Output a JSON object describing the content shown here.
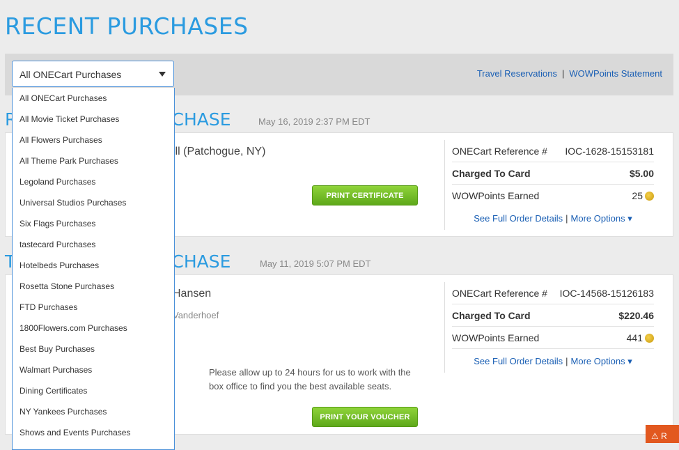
{
  "page": {
    "title": "RECENT PURCHASES"
  },
  "filter": {
    "selected": "All ONECart Purchases",
    "options": [
      "All ONECart Purchases",
      "All Movie Ticket Purchases",
      "All Flowers Purchases",
      "All Theme Park Purchases",
      "Legoland Purchases",
      "Universal Studios Purchases",
      "Six Flags Purchases",
      "tastecard Purchases",
      "Hotelbeds Purchases",
      "Rosetta Stone Purchases",
      "FTD Purchases",
      "1800Flowers.com Purchases",
      "Best Buy Purchases",
      "Walmart Purchases",
      "Dining Certificates",
      "NY Yankees Purchases",
      "Shows and Events Purchases"
    ]
  },
  "top_links": {
    "travel": "Travel Reservations",
    "separator": "|",
    "wowpoints": "WOWPoints Statement"
  },
  "purchases": [
    {
      "title_visible": "RCHASE",
      "title_prefix": "R",
      "date": "May 16, 2019 2:37 PM EDT",
      "venue_visible": "ill (Patchogue, NY)",
      "subline": "",
      "button": "PRINT CERTIFICATE",
      "notice": "",
      "ref_label": "ONECart Reference #",
      "ref_value": "IOC-1628-15153181",
      "charged_label": "Charged To Card",
      "charged_value": "$5.00",
      "points_label": "WOWPoints Earned",
      "points_value": "25",
      "details_link": "See Full Order Details",
      "options_link": "More Options ▾"
    },
    {
      "title_visible": "RCHASE",
      "title_prefix": "T",
      "date": "May 11, 2019 5:07 PM EDT",
      "venue_visible": "Hansen",
      "subline": "Vanderhoef",
      "button": "PRINT YOUR VOUCHER",
      "notice": "Please allow up to 24 hours for us to work with the box office to find you the best available seats.",
      "ref_label": "ONECart Reference #",
      "ref_value": "IOC-14568-15126183",
      "charged_label": "Charged To Card",
      "charged_value": "$220.46",
      "points_label": "WOWPoints Earned",
      "points_value": "441",
      "details_link": "See Full Order Details",
      "options_link": "More Options ▾"
    }
  ],
  "pipe": "|",
  "alert_tab": "⚠ R"
}
